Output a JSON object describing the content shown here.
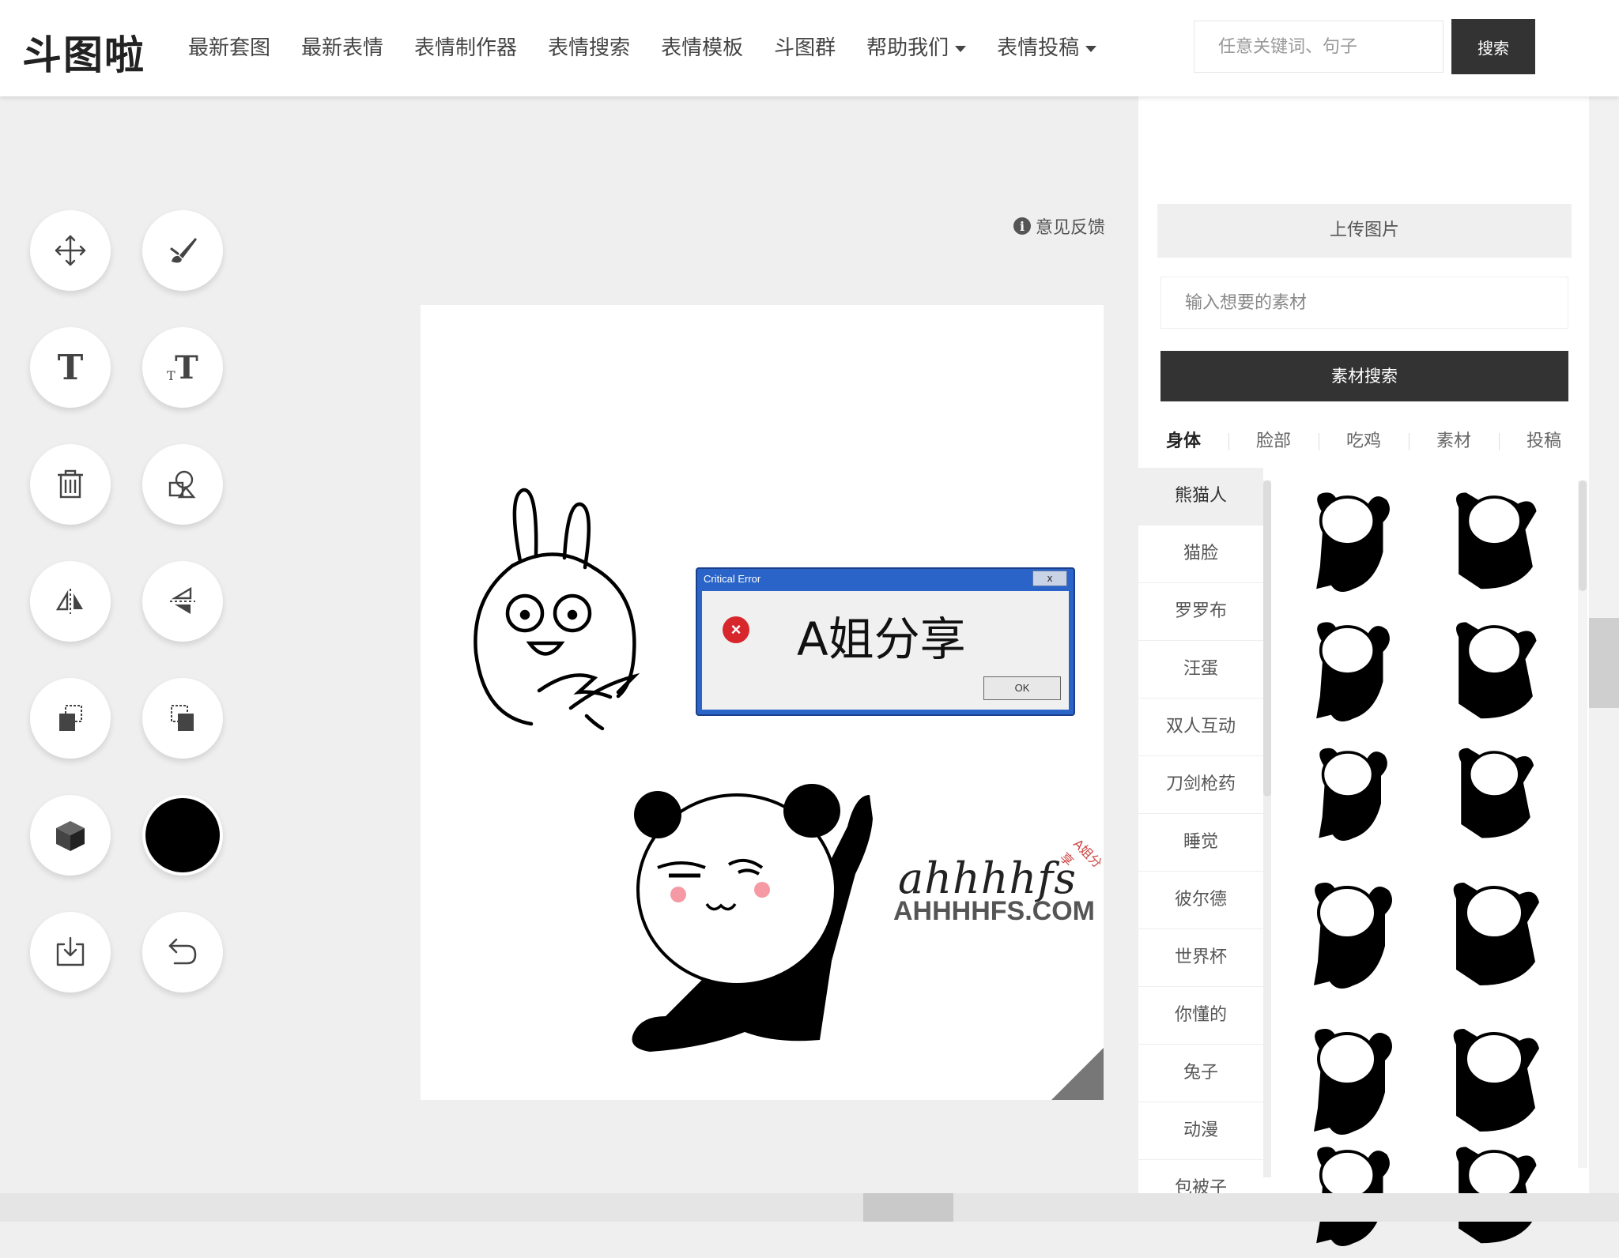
{
  "header": {
    "logo": "斗图啦",
    "nav": [
      {
        "label": "最新套图",
        "dropdown": false
      },
      {
        "label": "最新表情",
        "dropdown": false
      },
      {
        "label": "表情制作器",
        "dropdown": false
      },
      {
        "label": "表情搜索",
        "dropdown": false
      },
      {
        "label": "表情模板",
        "dropdown": false
      },
      {
        "label": "斗图群",
        "dropdown": false
      },
      {
        "label": "帮助我们",
        "dropdown": true
      },
      {
        "label": "表情投稿",
        "dropdown": true
      }
    ],
    "search_placeholder": "任意关键词、句子",
    "search_button": "搜索"
  },
  "toolbar": {
    "tools": [
      {
        "icon": "move-icon"
      },
      {
        "icon": "brush-icon"
      },
      {
        "icon": "add-text-icon"
      },
      {
        "icon": "add-vertical-text-icon"
      },
      {
        "icon": "trash-icon"
      },
      {
        "icon": "shapes-icon"
      },
      {
        "icon": "flip-horizontal-icon"
      },
      {
        "icon": "flip-vertical-icon"
      },
      {
        "icon": "bring-forward-icon"
      },
      {
        "icon": "send-backward-icon"
      },
      {
        "icon": "cube-icon"
      },
      {
        "icon": "color-picker",
        "color": "#000000"
      },
      {
        "icon": "download-icon"
      },
      {
        "icon": "undo-icon"
      }
    ]
  },
  "feedback": "意见反馈",
  "canvas": {
    "dialog_title": "Critical Error",
    "dialog_close": "x",
    "dialog_message": "A姐分享",
    "dialog_ok": "OK",
    "watermark_script": "ahhhhfs",
    "watermark_domain": "AHHHHFS.COM",
    "watermark_stamp": "A姐分享"
  },
  "right_panel": {
    "upload_button": "上传图片",
    "material_placeholder": "输入想要的素材",
    "material_button": "素材搜索",
    "tabs": [
      "身体",
      "脸部",
      "吃鸡",
      "素材",
      "投稿"
    ],
    "active_tab": 0,
    "sub_categories": [
      "熊猫人",
      "猫脸",
      "罗罗布",
      "汪蛋",
      "双人互动",
      "刀剑枪药",
      "睡觉",
      "彼尔德",
      "世界杯",
      "你懂的",
      "兔子",
      "动漫",
      "包被子"
    ],
    "active_sub": 0,
    "sticker_count": 12
  }
}
